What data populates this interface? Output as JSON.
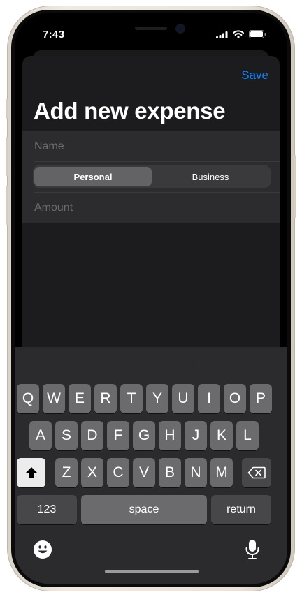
{
  "status": {
    "time": "7:43"
  },
  "nav": {
    "save_label": "Save"
  },
  "page": {
    "title": "Add new expense"
  },
  "form": {
    "name_placeholder": "Name",
    "name_value": "",
    "type_options": [
      "Personal",
      "Business"
    ],
    "type_selected": "Personal",
    "amount_placeholder": "Amount",
    "amount_value": ""
  },
  "keyboard": {
    "row1": [
      "Q",
      "W",
      "E",
      "R",
      "T",
      "Y",
      "U",
      "I",
      "O",
      "P"
    ],
    "row2": [
      "A",
      "S",
      "D",
      "F",
      "G",
      "H",
      "J",
      "K",
      "L"
    ],
    "row3": [
      "Z",
      "X",
      "C",
      "V",
      "B",
      "N",
      "M"
    ],
    "numbers_label": "123",
    "space_label": "space",
    "return_label": "return",
    "shift_icon": "shift-arrow-icon",
    "delete_icon": "backspace-icon",
    "emoji_icon": "emoji-icon",
    "dictation_icon": "microphone-icon"
  },
  "colors": {
    "accent": "#0a84ff",
    "sheet_background": "#1c1c1e",
    "keyboard_background": "#2b2b2d"
  }
}
